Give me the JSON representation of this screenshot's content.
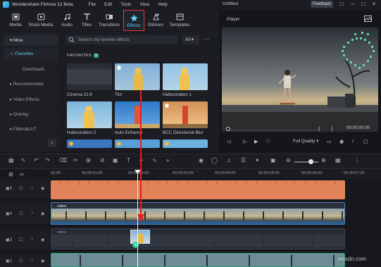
{
  "app": {
    "name": "Wondershare Filmora 12 Beta",
    "doc_title": "Untitled",
    "feedback": "Feedback"
  },
  "menu": [
    "File",
    "Edit",
    "Tools",
    "View",
    "Help"
  ],
  "toolbar": [
    {
      "label": "Media",
      "icon": "media-icon"
    },
    {
      "label": "Stock Media",
      "icon": "stock-media-icon"
    },
    {
      "label": "Audio",
      "icon": "audio-icon"
    },
    {
      "label": "Titles",
      "icon": "titles-icon"
    },
    {
      "label": "Transitions",
      "icon": "transitions-icon"
    },
    {
      "label": "Effects",
      "icon": "effects-icon",
      "active": true
    },
    {
      "label": "Stickers",
      "icon": "stickers-icon"
    },
    {
      "label": "Templates",
      "icon": "templates-icon"
    }
  ],
  "sidebar": {
    "items": [
      {
        "label": "Mine"
      },
      {
        "label": "Favorites"
      },
      {
        "label": "Downloads"
      },
      {
        "label": "Recommended"
      },
      {
        "label": "Video Effects"
      },
      {
        "label": "Overlay"
      },
      {
        "label": "Filters&LUT"
      }
    ]
  },
  "library": {
    "search_placeholder": "Search my favorite effects",
    "filter": "All",
    "favorites_label": "FAVORITES",
    "favorites_count": "9",
    "thumbnails": [
      {
        "name": "Cinema 21:9"
      },
      {
        "name": "Tint"
      },
      {
        "name": "Hallucination 1"
      },
      {
        "name": "Hallucination 2"
      },
      {
        "name": "Auto Enhance"
      },
      {
        "name": "BCC Directional Blur"
      }
    ]
  },
  "player": {
    "title": "Player",
    "timecode": "00:00:00:00",
    "quality": "Full Quality"
  },
  "ruler": [
    "00:00",
    "00:00:01:00",
    "00:00:02:00",
    "00:00:03:00",
    "00:00:04:00",
    "00:00:05:00",
    "00:00:06:00",
    "00:00:07:00"
  ],
  "tracks": [
    {
      "number": "6"
    },
    {
      "number": "4"
    },
    {
      "number": "3"
    },
    {
      "number": "2"
    }
  ],
  "clips": {
    "video_label": "video"
  },
  "watermark": "wsxdn.com",
  "colors": {
    "accent": "#5fd0ff",
    "highlight_border": "#e23b3b",
    "effect_clip": "#e28258",
    "arrow": "#e02020"
  }
}
